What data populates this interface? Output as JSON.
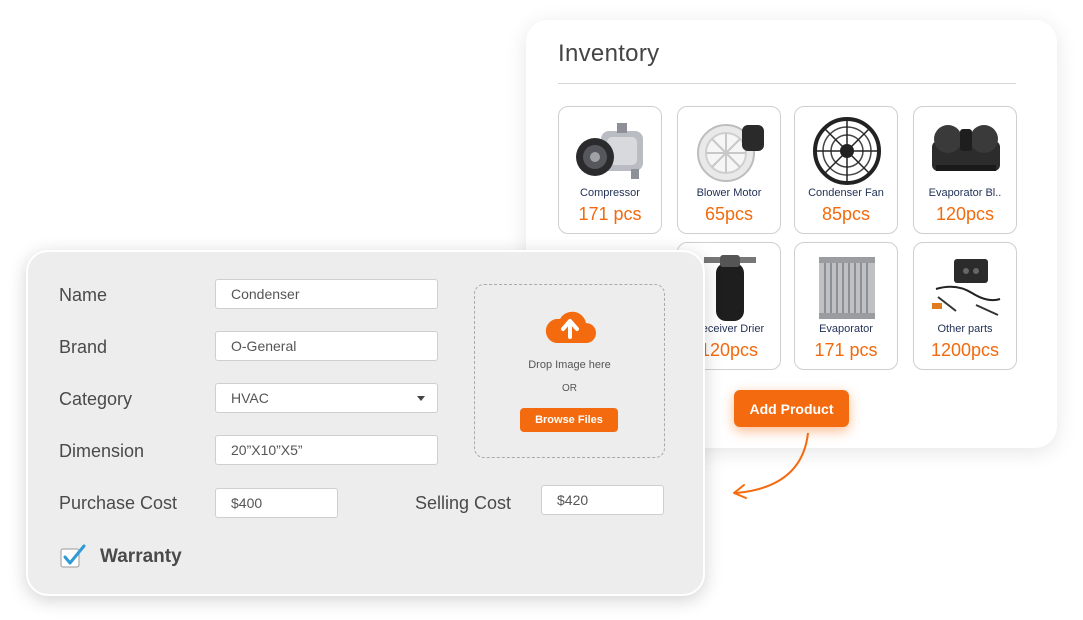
{
  "inventory": {
    "title": "Inventory",
    "items": [
      {
        "name": "Compressor",
        "qty": "171 pcs",
        "icon": "compressor-icon"
      },
      {
        "name": "Blower Motor",
        "qty": "65pcs",
        "icon": "blower-motor-icon"
      },
      {
        "name": "Condenser Fan",
        "qty": "85pcs",
        "icon": "condenser-fan-icon"
      },
      {
        "name": "Evaporator Bl..",
        "qty": "120pcs",
        "icon": "evaporator-blower-icon"
      },
      {
        "name": "Receiver Drier",
        "qty": "120pcs",
        "icon": "receiver-drier-icon"
      },
      {
        "name": "Evaporator",
        "qty": "171 pcs",
        "icon": "evaporator-icon"
      },
      {
        "name": "Other parts",
        "qty": "1200pcs",
        "icon": "other-parts-icon"
      }
    ],
    "add_product_label": "Add Product"
  },
  "form": {
    "name_label": "Name",
    "name_value": "Condenser",
    "brand_label": "Brand",
    "brand_value": "O-General",
    "category_label": "Category",
    "category_value": "HVAC",
    "dimension_label": "Dimension",
    "dimension_value": "20”X10”X5”",
    "purchase_cost_label": "Purchase Cost",
    "purchase_cost_value": "$400",
    "selling_cost_label": "Selling Cost",
    "selling_cost_value": "$420",
    "warranty_label": "Warranty",
    "warranty_checked": true
  },
  "upload": {
    "drop_text": "Drop Image here",
    "or_text": "OR",
    "browse_label": "Browse Files",
    "icon": "cloud-upload-icon"
  },
  "colors": {
    "accent": "#f46b0f",
    "quantity": "#f26a0e",
    "item_name": "#1f2f55",
    "checkbox": "#2f9bd6",
    "form_bg": "#eeedee"
  }
}
